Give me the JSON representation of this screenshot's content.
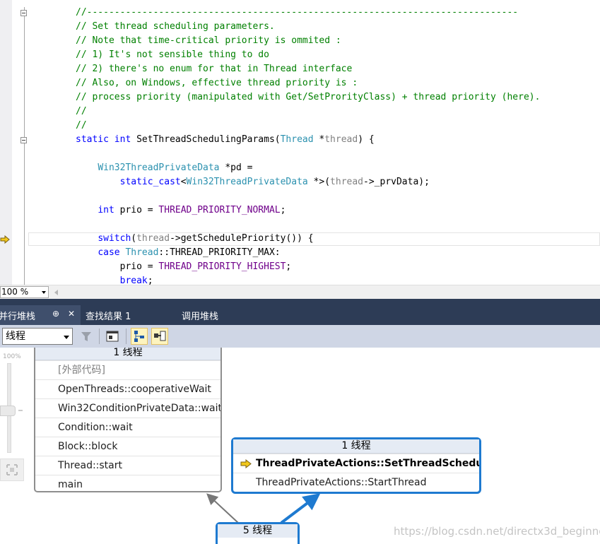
{
  "editor": {
    "lines": [
      {
        "parts": [
          {
            "c": "c",
            "t": "//------------------------------------------------------------------------------"
          }
        ]
      },
      {
        "parts": [
          {
            "c": "c",
            "t": "// Set thread scheduling parameters."
          }
        ]
      },
      {
        "parts": [
          {
            "c": "c",
            "t": "// Note that time-critical priority is ommited :"
          }
        ]
      },
      {
        "parts": [
          {
            "c": "c",
            "t": "// 1) It's not sensible thing to do"
          }
        ]
      },
      {
        "parts": [
          {
            "c": "c",
            "t": "// 2) there's no enum for that in Thread interface"
          }
        ]
      },
      {
        "parts": [
          {
            "c": "c",
            "t": "// Also, on Windows, effective thread priority is :"
          }
        ]
      },
      {
        "parts": [
          {
            "c": "c",
            "t": "// process priority (manipulated with Get/SetProrityClass) + thread priority (here)."
          }
        ]
      },
      {
        "parts": [
          {
            "c": "c",
            "t": "//"
          }
        ]
      },
      {
        "parts": [
          {
            "c": "c",
            "t": "//"
          }
        ]
      },
      {
        "parts": [
          {
            "c": "k",
            "t": "static"
          },
          {
            "c": "",
            "t": " "
          },
          {
            "c": "k",
            "t": "int"
          },
          {
            "c": "",
            "t": " SetThreadSchedulingParams("
          },
          {
            "c": "t",
            "t": "Thread"
          },
          {
            "c": "",
            "t": " *"
          },
          {
            "c": "p",
            "t": "thread"
          },
          {
            "c": "",
            "t": ") {"
          }
        ]
      },
      {
        "parts": []
      },
      {
        "parts": [
          {
            "c": "",
            "t": "    "
          },
          {
            "c": "t",
            "t": "Win32ThreadPrivateData"
          },
          {
            "c": "",
            "t": " *pd ="
          }
        ]
      },
      {
        "parts": [
          {
            "c": "",
            "t": "        "
          },
          {
            "c": "k",
            "t": "static_cast"
          },
          {
            "c": "",
            "t": "<"
          },
          {
            "c": "t",
            "t": "Win32ThreadPrivateData"
          },
          {
            "c": "",
            "t": " *>("
          },
          {
            "c": "p",
            "t": "thread"
          },
          {
            "c": "",
            "t": "->_prvData);"
          }
        ]
      },
      {
        "parts": []
      },
      {
        "parts": [
          {
            "c": "",
            "t": "    "
          },
          {
            "c": "k",
            "t": "int"
          },
          {
            "c": "",
            "t": " prio = "
          },
          {
            "c": "m",
            "t": "THREAD_PRIORITY_NORMAL"
          },
          {
            "c": "",
            "t": ";"
          }
        ]
      },
      {
        "parts": []
      },
      {
        "parts": [
          {
            "c": "",
            "t": "    "
          },
          {
            "c": "k",
            "t": "switch"
          },
          {
            "c": "",
            "t": "("
          },
          {
            "c": "p",
            "t": "thread"
          },
          {
            "c": "",
            "t": "->getSchedulePriority()) {"
          }
        ]
      },
      {
        "parts": [
          {
            "c": "",
            "t": "    "
          },
          {
            "c": "k",
            "t": "case"
          },
          {
            "c": "",
            "t": " "
          },
          {
            "c": "t",
            "t": "Thread"
          },
          {
            "c": "",
            "t": "::THREAD_PRIORITY_MAX:"
          }
        ]
      },
      {
        "parts": [
          {
            "c": "",
            "t": "        prio = "
          },
          {
            "c": "m",
            "t": "THREAD_PRIORITY_HIGHEST"
          },
          {
            "c": "",
            "t": ";"
          }
        ]
      },
      {
        "parts": [
          {
            "c": "",
            "t": "        "
          },
          {
            "c": "k",
            "t": "break"
          },
          {
            "c": "",
            "t": ";"
          }
        ]
      }
    ],
    "zoom": "100 %"
  },
  "tabs": {
    "parallel_stacks": "并行堆栈",
    "find_results": "查找结果 1",
    "call_stack": "调用堆栈",
    "pin": "⊕",
    "close": "✕"
  },
  "toolbar": {
    "view_mode": "线程"
  },
  "graph": {
    "zoom_label": "100%",
    "left_node": {
      "header": "1 线程",
      "frames": [
        "[外部代码]",
        "OpenThreads::cooperativeWait",
        "Win32ConditionPrivateData::wait",
        "Condition::wait",
        "Block::block",
        "Thread::start",
        "main"
      ]
    },
    "right_node": {
      "header": "1 线程",
      "frames": [
        "ThreadPrivateActions::SetThreadScheduli...",
        "ThreadPrivateActions::StartThread"
      ]
    },
    "bottom_node": {
      "header": "5 线程"
    }
  },
  "watermark": "https://blog.csdn.net/directx3d_beginner",
  "colors": {
    "accent_blue": "#1e7ad0",
    "tab_bar": "#2d3c56",
    "toolbar": "#cfd6e5",
    "exec_arrow": "#f2c81b"
  }
}
